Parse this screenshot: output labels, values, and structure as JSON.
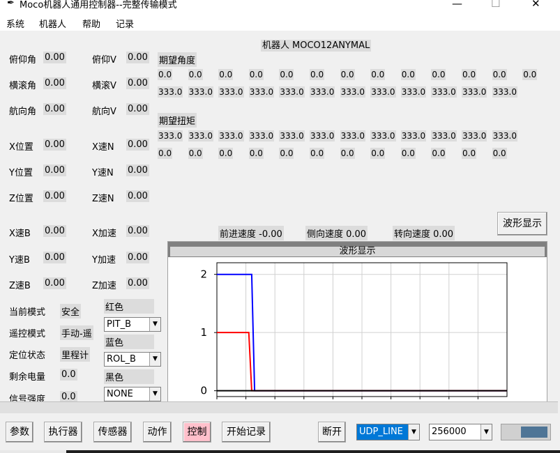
{
  "window": {
    "title": "Moco机器人通用控制器--完整传输模式",
    "min": "—",
    "max": "☐",
    "close": "✕"
  },
  "menu": [
    "系统",
    "机器人",
    "帮助",
    "记录"
  ],
  "robot": {
    "label": "机器人",
    "name": "MOCO12ANYMAL"
  },
  "state": {
    "pitch_label": "俯仰角",
    "pitch": "0.00",
    "pitchv_label": "俯仰V",
    "pitchv": "0.00",
    "roll_label": "横滚角",
    "roll": "0.00",
    "rollv_label": "横滚V",
    "rollv": "0.00",
    "yaw_label": "航向角",
    "yaw": "0.00",
    "yawv_label": "航向V",
    "yawv": "0.00",
    "xpos_label": "X位置",
    "xpos": "0.00",
    "xn_label": "X速N",
    "xn": "0.00",
    "ypos_label": "Y位置",
    "ypos": "0.00",
    "yn_label": "Y速N",
    "yn": "0.00",
    "zpos_label": "Z位置",
    "zpos": "0.00",
    "zn_label": "Z速N",
    "zn": "0.00",
    "xb_label": "X速B",
    "xb": "0.00",
    "xacc_label": "X加速",
    "xacc": "0.00",
    "yb_label": "Y速B",
    "yb": "0.00",
    "yacc_label": "Y加速",
    "yacc": "0.00",
    "zb_label": "Z速B",
    "zb": "0.00",
    "zacc_label": "Z加速",
    "zacc": "0.00"
  },
  "status": {
    "mode_label": "当前模式",
    "mode": "安全",
    "remote_label": "遥控模式",
    "remote": "手动-遥",
    "loc_label": "定位状态",
    "loc": "里程计",
    "battery_label": "剩余电量",
    "battery": "0.0",
    "signal_label": "信号强度",
    "signal": "0.0"
  },
  "colors": {
    "red_label": "红色",
    "red_select": "PIT_B",
    "blue_label": "蓝色",
    "blue_select": "ROL_B",
    "black_label": "黑色",
    "black_select": "NONE"
  },
  "desired_angle": {
    "label": "期望角度",
    "row1": [
      "0.0",
      "0.0",
      "0.0",
      "0.0",
      "0.0",
      "0.0",
      "0.0",
      "0.0",
      "0.0",
      "0.0",
      "0.0",
      "0.0",
      "0.0"
    ],
    "row2": [
      "333.0",
      "333.0",
      "333.0",
      "333.0",
      "333.0",
      "333.0",
      "333.0",
      "333.0",
      "333.0",
      "333.0",
      "333.0",
      "333.0"
    ]
  },
  "desired_torque": {
    "label": "期望扭矩",
    "row1": [
      "333.0",
      "333.0",
      "333.0",
      "333.0",
      "333.0",
      "333.0",
      "333.0",
      "333.0",
      "333.0",
      "333.0",
      "333.0",
      "333.0"
    ],
    "row2": [
      "0.0",
      "0.0",
      "0.0",
      "0.0",
      "0.0",
      "0.0",
      "0.0",
      "0.0",
      "0.0",
      "0.0",
      "0.0",
      "0.0"
    ]
  },
  "speeds": {
    "forward": "前进速度 -0.00",
    "lateral": "侧向速度 0.00",
    "turn": "转向速度 0.00"
  },
  "wave_button": "波形显示",
  "plot_title": "波形显示",
  "chart_data": {
    "type": "line",
    "xlim": [
      0,
      100
    ],
    "ylim": [
      -0.1,
      2.2
    ],
    "xticks": [
      "0",
      "10",
      "20",
      "30",
      "40",
      "50",
      "60",
      "70",
      "80",
      "90"
    ],
    "yticks": [
      "0",
      "1",
      "2"
    ],
    "grid": true,
    "series": [
      {
        "color": "#0000ff",
        "x": [
          0,
          12,
          13,
          100
        ],
        "y": [
          2,
          2,
          0,
          0
        ]
      },
      {
        "color": "#ff0000",
        "x": [
          0,
          11,
          12,
          100
        ],
        "y": [
          1,
          1,
          0,
          0
        ]
      },
      {
        "color": "#000000",
        "x": [
          0,
          100
        ],
        "y": [
          0,
          0
        ]
      }
    ]
  },
  "bottom": {
    "params": "参数",
    "actuator": "执行器",
    "sensor": "传感器",
    "action": "动作",
    "control": "控制",
    "start_record": "开始记录",
    "disconnect": "断开",
    "port": "UDP_LINE",
    "baud": "256000"
  }
}
